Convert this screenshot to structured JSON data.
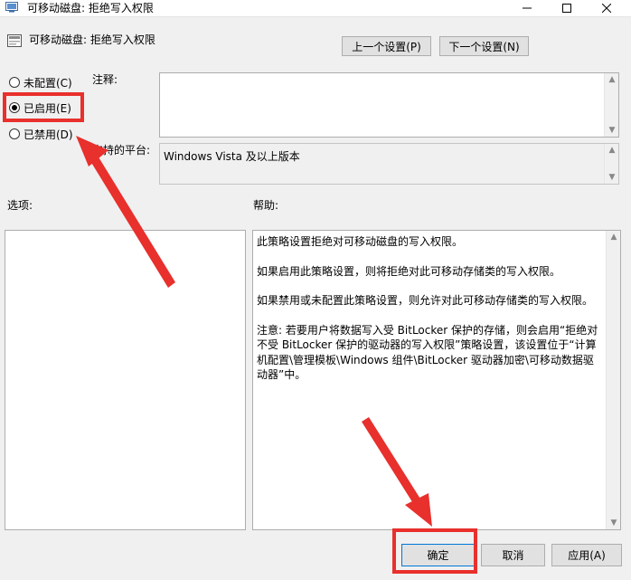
{
  "window": {
    "title": "可移动磁盘: 拒绝写入权限",
    "controls": {
      "minimize_icon": "minimize-icon",
      "maximize_icon": "maximize-icon",
      "close_icon": "close-icon"
    }
  },
  "header": {
    "policy_name": "可移动磁盘: 拒绝写入权限",
    "prev_label": "上一个设置(P)",
    "next_label": "下一个设置(N)"
  },
  "state": {
    "options": [
      {
        "label": "未配置(C)",
        "selected": false
      },
      {
        "label": "已启用(E)",
        "selected": true
      },
      {
        "label": "已禁用(D)",
        "selected": false
      }
    ]
  },
  "comment": {
    "label": "注释:",
    "value": ""
  },
  "platform": {
    "label": "支持的平台:",
    "value": "Windows Vista 及以上版本"
  },
  "options_label": "选项:",
  "help": {
    "label": "帮助:",
    "paragraphs": [
      "此策略设置拒绝对可移动磁盘的写入权限。",
      "如果启用此策略设置，则将拒绝对此可移动存储类的写入权限。",
      "如果禁用或未配置此策略设置，则允许对此可移动存储类的写入权限。",
      "注意: 若要用户将数据写入受 BitLocker 保护的存储，则会启用“拒绝对不受 BitLocker 保护的驱动器的写入权限”策略设置，该设置位于“计算机配置\\管理模板\\Windows 组件\\BitLocker 驱动器加密\\可移动数据驱动器”中。"
    ]
  },
  "footer": {
    "ok_label": "确定",
    "cancel_label": "取消",
    "apply_label": "应用(A)"
  },
  "colors": {
    "annotation_red": "#e8302c",
    "primary_border": "#0078d7"
  }
}
